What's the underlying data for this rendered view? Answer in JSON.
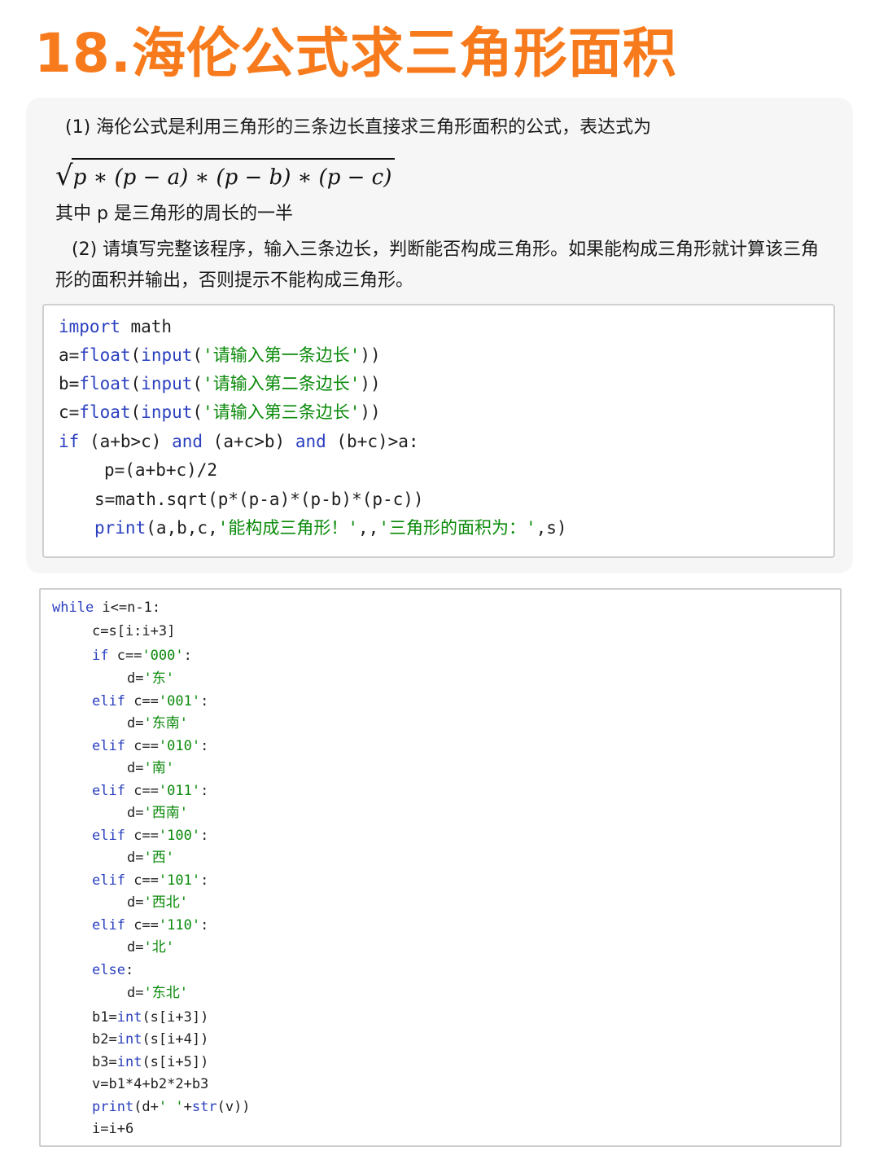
{
  "title": "18.海伦公式求三角形面积",
  "intro": {
    "p1": "(1) 海伦公式是利用三角形的三条边长直接求三角形面积的公式，表达式为",
    "formula": "p ∗ (p − a) ∗ (p − b) ∗ (p − c)",
    "p3": "其中 p 是三角形的周长的一半",
    "p4": "(2) 请填写完整该程序，输入三条边长，判断能否构成三角形。如果能构成三角形就计算该三角形的面积并输出，否则提示不能构成三角形。"
  },
  "code1": {
    "l1": {
      "kw": "import",
      "rest": " math"
    },
    "l2": {
      "a": "a=",
      "fn1": "float",
      "p1": "(",
      "fn2": "input",
      "p2": "(",
      "str": "'请输入第一条边长'",
      "p3": "))"
    },
    "l3": {
      "a": "b=",
      "fn1": "float",
      "p1": "(",
      "fn2": "input",
      "p2": "(",
      "str": "'请输入第二条边长'",
      "p3": "))"
    },
    "l4": {
      "a": "c=",
      "fn1": "float",
      "p1": "(",
      "fn2": "input",
      "p2": "(",
      "str": "'请输入第三条边长'",
      "p3": "))"
    },
    "l5": {
      "kw1": "if",
      "t1": " (a+b>c) ",
      "kw2": "and",
      "t2": " (a+c>b) ",
      "kw3": "and",
      "t3": " (b+c)>a:"
    },
    "l6": "p=(a+b+c)/2",
    "l7": "s=math.sqrt(p*(p-a)*(p-b)*(p-c))",
    "l8": {
      "fn": "print",
      "t1": "(a,b,c,",
      "s1": "'能构成三角形！'",
      "t2": ",,",
      "s2": "'三角形的面积为：'",
      "t3": ",s)"
    }
  },
  "code2": {
    "l1": {
      "kw": "while",
      "rest": " i<=n-1:"
    },
    "l2": "c=s[i:i+3]",
    "l3": {
      "kw": "if",
      "t": " c==",
      "s": "'000'",
      "e": ":"
    },
    "l4": {
      "t": "d=",
      "s": "'东'"
    },
    "l5": {
      "kw": "elif",
      "t": " c==",
      "s": "'001'",
      "e": ":"
    },
    "l6": {
      "t": "d=",
      "s": "'东南'"
    },
    "l7": {
      "kw": "elif",
      "t": " c==",
      "s": "'010'",
      "e": ":"
    },
    "l8": {
      "t": "d=",
      "s": "'南'"
    },
    "l9": {
      "kw": "elif",
      "t": " c==",
      "s": "'011'",
      "e": ":"
    },
    "l10": {
      "t": "d=",
      "s": "'西南'"
    },
    "l11": {
      "kw": "elif",
      "t": " c==",
      "s": "'100'",
      "e": ":"
    },
    "l12": {
      "t": "d=",
      "s": "'西'"
    },
    "l13": {
      "kw": "elif",
      "t": " c==",
      "s": "'101'",
      "e": ":"
    },
    "l14": {
      "t": "d=",
      "s": "'西北'"
    },
    "l15": {
      "kw": "elif",
      "t": " c==",
      "s": "'110'",
      "e": ":"
    },
    "l16": {
      "t": "d=",
      "s": "'北'"
    },
    "l17": {
      "kw": "else",
      "e": ":"
    },
    "l18": {
      "t": "d=",
      "s": "'东北'"
    },
    "l19": {
      "a": "b1=",
      "fn": "int",
      "b": "(s[i+3])"
    },
    "l20": {
      "a": "b2=",
      "fn": "int",
      "b": "(s[i+4])"
    },
    "l21": {
      "a": "b3=",
      "fn": "int",
      "b": "(s[i+5])"
    },
    "l22": "v=b1*4+b2*2+b3",
    "l23": {
      "fn1": "print",
      "a": "(d+",
      "s": "' '",
      "b": "+",
      "fn2": "str",
      "c": "(v))"
    },
    "l24": "i=i+6"
  },
  "colors": {
    "title": "#f77b1d",
    "keyword": "#2a3fbf",
    "string": "#0a8a0a",
    "card_bg": "#f6f6f6"
  }
}
